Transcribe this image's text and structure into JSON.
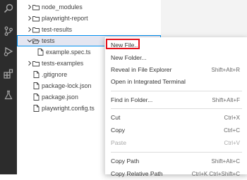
{
  "activity_bar": {
    "icons": [
      "search-icon",
      "source-control-icon",
      "run-debug-icon",
      "extensions-icon",
      "testing-icon"
    ]
  },
  "explorer": {
    "rows": [
      {
        "label": "node_modules",
        "kind": "folder",
        "expanded": false
      },
      {
        "label": "playwright-report",
        "kind": "folder",
        "expanded": false
      },
      {
        "label": "test-results",
        "kind": "folder",
        "expanded": false
      },
      {
        "label": "tests",
        "kind": "folder",
        "expanded": true,
        "selected": true
      },
      {
        "label": "example.spec.ts",
        "kind": "file"
      },
      {
        "label": "tests-examples",
        "kind": "folder",
        "expanded": false
      },
      {
        "label": ".gitignore",
        "kind": "file"
      },
      {
        "label": "package-lock.json",
        "kind": "file"
      },
      {
        "label": "package.json",
        "kind": "file"
      },
      {
        "label": "playwright.config.ts",
        "kind": "file"
      }
    ]
  },
  "context_menu": {
    "items": [
      {
        "label": "New File...",
        "shortcut": ""
      },
      {
        "label": "New Folder...",
        "shortcut": ""
      },
      {
        "label": "Reveal in File Explorer",
        "shortcut": "Shift+Alt+R"
      },
      {
        "label": "Open in Integrated Terminal",
        "shortcut": ""
      },
      {
        "label": "Find in Folder...",
        "shortcut": "Shift+Alt+F"
      },
      {
        "label": "Cut",
        "shortcut": "Ctrl+X"
      },
      {
        "label": "Copy",
        "shortcut": "Ctrl+C"
      },
      {
        "label": "Paste",
        "shortcut": "Ctrl+V",
        "disabled": true
      },
      {
        "label": "Copy Path",
        "shortcut": "Shift+Alt+C"
      },
      {
        "label": "Copy Relative Path",
        "shortcut": "Ctrl+K Ctrl+Shift+C"
      }
    ]
  },
  "colors": {
    "activity_bar_bg": "#2c2c2c",
    "selection_border": "#0090f1",
    "highlight_box": "#e3101b",
    "editor_bg": "#f3f3f3"
  }
}
